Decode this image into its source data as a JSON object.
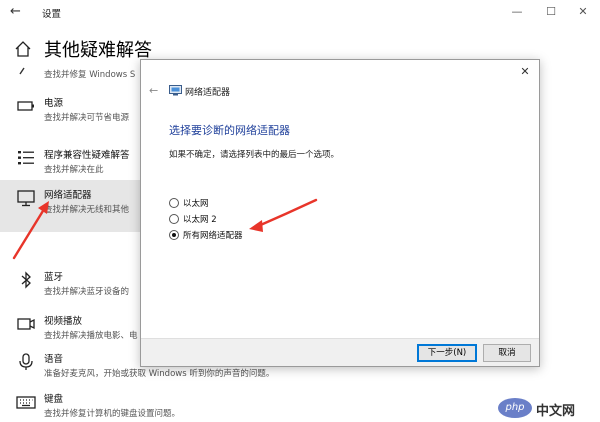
{
  "window": {
    "title": "设置"
  },
  "page": {
    "title": "其他疑难解答"
  },
  "items": [
    {
      "name": "",
      "desc": "查找并修复 Windows S",
      "icon": "partial-icon"
    },
    {
      "name": "电源",
      "desc": "查找并解决可节省电源",
      "icon": "battery-icon"
    },
    {
      "name": "程序兼容性疑难解答",
      "desc": "查找并解决在此",
      "icon": "compat-list-icon"
    },
    {
      "name": "网络适配器",
      "desc": "查找并解决无线和其他",
      "icon": "network-adapter-icon"
    },
    {
      "name": "蓝牙",
      "desc": "查找并解决蓝牙设备的",
      "icon": "bluetooth-icon"
    },
    {
      "name": "视频播放",
      "desc": "查找并解决播放电影、电",
      "icon": "video-icon"
    },
    {
      "name": "语音",
      "desc": "准备好麦克风，开始或获取 Windows 听到你的声音的问题。",
      "icon": "microphone-icon"
    },
    {
      "name": "键盘",
      "desc": "查找并修复计算机的键盘设置问题。",
      "icon": "keyboard-icon"
    }
  ],
  "dialog": {
    "app_title": "网络适配器",
    "heading": "选择要诊断的网络适配器",
    "instruction": "如果不确定，请选择列表中的最后一个选项。",
    "options": [
      {
        "label": "以太网",
        "checked": false
      },
      {
        "label": "以太网 2",
        "checked": false
      },
      {
        "label": "所有网络适配器",
        "checked": true
      }
    ],
    "next_label": "下一步(N)",
    "cancel_label": "取消"
  },
  "watermark": {
    "logo_text": "php",
    "text": "中文网"
  },
  "colors": {
    "heading_blue": "#1e3f9a",
    "annotation_red": "#e8352a",
    "selected_bg": "#e6e6e6"
  }
}
